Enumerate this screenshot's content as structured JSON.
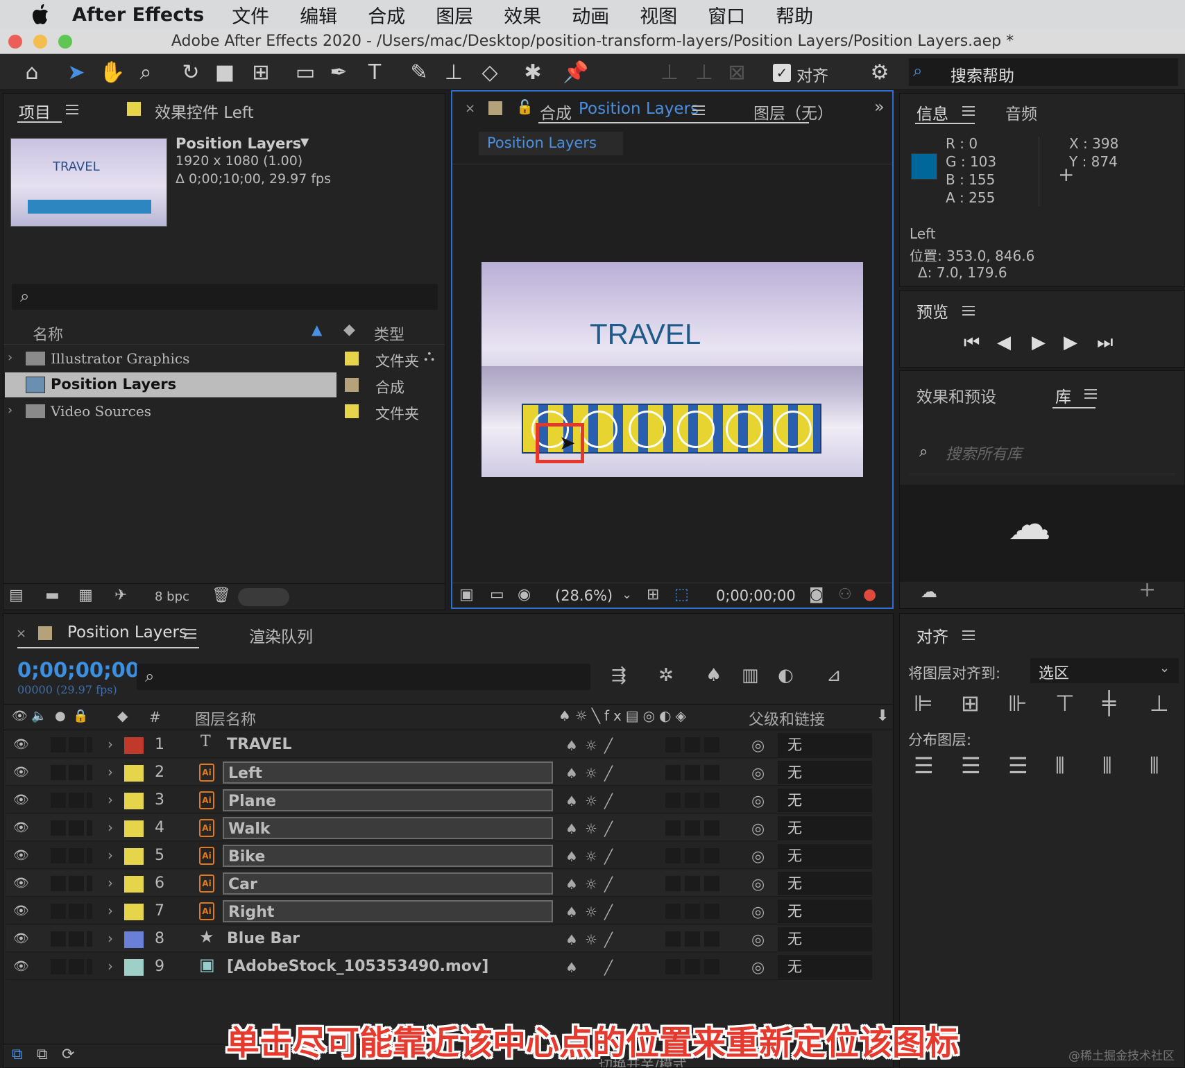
{
  "menubar": {
    "app": "After Effects",
    "items": [
      "文件",
      "编辑",
      "合成",
      "图层",
      "效果",
      "动画",
      "视图",
      "窗口",
      "帮助"
    ]
  },
  "window": {
    "title": "Adobe After Effects 2020 - /Users/mac/Desktop/position-transform-layers/Position Layers/Position Layers.aep *"
  },
  "toolbar": {
    "align_label": "对齐",
    "search_help": "搜索帮助"
  },
  "project": {
    "tab": "项目",
    "effects_tab": "效果控件 Left",
    "comp_name": "Position Layers",
    "comp_size": "1920 x 1080 (1.00)",
    "comp_duration": "Δ 0;00;10;00, 29.97 fps",
    "thumb_text": "TRAVEL",
    "col_name": "名称",
    "col_type": "类型",
    "items": [
      {
        "name": "Illustrator Graphics",
        "type": "文件夹",
        "color": "#e6d44a"
      },
      {
        "name": "Position Layers",
        "type": "合成",
        "color": "#b5a27a"
      },
      {
        "name": "Video Sources",
        "type": "文件夹",
        "color": "#e6d44a"
      }
    ],
    "bpc": "8 bpc"
  },
  "composition": {
    "tab_prefix": "合成",
    "tab_name": "Position Layers",
    "layer_tab": "图层（无）",
    "subtab": "Position Layers",
    "canvas_title": "TRAVEL",
    "zoom": "(28.6%)",
    "timecode": "0;00;00;00"
  },
  "info": {
    "tab": "信息",
    "audio_tab": "音频",
    "r": "R :  0",
    "g": "G :  103",
    "b": "B :  155",
    "a": "A :  255",
    "x": "X :  398",
    "y": "Y :  874",
    "layer": "Left",
    "position": "位置: 353.0, 846.6",
    "delta": "Δ: 7.0, 179.6",
    "color": "#00679b"
  },
  "preview": {
    "tab": "预览"
  },
  "effects": {
    "tab": "效果和预设",
    "library_tab": "库",
    "search_placeholder": "搜索所有库"
  },
  "timeline": {
    "tab": "Position Layers",
    "render_tab": "渲染队列",
    "timecode": "0;00;00;00",
    "frames": "00000 (29.97 fps)",
    "col_layer_name": "图层名称",
    "col_parent": "父级和链接",
    "layers": [
      {
        "num": "1",
        "name": "TRAVEL",
        "color": "#c0392b",
        "type": "text",
        "parent": "无"
      },
      {
        "num": "2",
        "name": "Left",
        "color": "#e6d44a",
        "type": "ai",
        "parent": "无"
      },
      {
        "num": "3",
        "name": "Plane",
        "color": "#e6d44a",
        "type": "ai",
        "parent": "无"
      },
      {
        "num": "4",
        "name": "Walk",
        "color": "#e6d44a",
        "type": "ai",
        "parent": "无"
      },
      {
        "num": "5",
        "name": "Bike",
        "color": "#e6d44a",
        "type": "ai",
        "parent": "无"
      },
      {
        "num": "6",
        "name": "Car",
        "color": "#e6d44a",
        "type": "ai",
        "parent": "无"
      },
      {
        "num": "7",
        "name": "Right",
        "color": "#e6d44a",
        "type": "ai",
        "parent": "无"
      },
      {
        "num": "8",
        "name": "Blue Bar",
        "color": "#6a7fd8",
        "type": "shape",
        "parent": "无"
      },
      {
        "num": "9",
        "name": "[AdobeStock_105353490.mov]",
        "color": "#9fd0c8",
        "type": "video",
        "parent": "无"
      }
    ],
    "footer": "切换开关/模式"
  },
  "align": {
    "tab": "对齐",
    "align_to_label": "将图层对齐到:",
    "align_to_value": "选区",
    "distribute_label": "分布图层:"
  },
  "subtitle": "单击尽可能靠近该中心点的位置来重新定位该图标",
  "watermark": "@稀土掘金技术社区"
}
